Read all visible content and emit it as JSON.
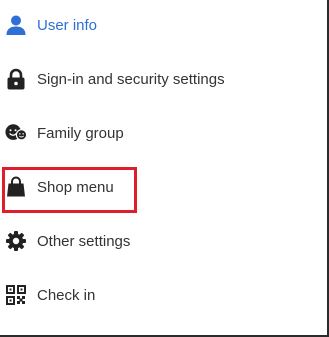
{
  "menu": {
    "items": [
      {
        "label": "User info",
        "icon": "user-icon",
        "active": true
      },
      {
        "label": "Sign-in and security settings",
        "icon": "lock-icon",
        "active": false
      },
      {
        "label": "Family group",
        "icon": "family-group-icon",
        "active": false
      },
      {
        "label": "Shop menu",
        "icon": "shopping-bag-icon",
        "active": false,
        "highlighted": true
      },
      {
        "label": "Other settings",
        "icon": "gear-icon",
        "active": false
      },
      {
        "label": "Check in",
        "icon": "qr-code-icon",
        "active": false
      }
    ]
  },
  "colors": {
    "active_text": "#2f6fd6",
    "default_text": "#333333",
    "icon": "#222222",
    "highlight_border": "#e01e2b"
  }
}
